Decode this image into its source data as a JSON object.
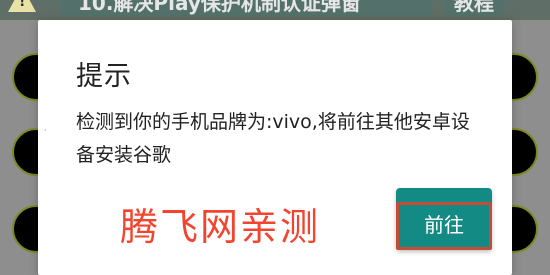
{
  "background": {
    "title_button": "10.解决Play保护机制认证弹窗",
    "tutorial_button": "教程"
  },
  "dialog": {
    "title": "提示",
    "message": "检测到你的手机品牌为:vivo,将前往其他安卓设备安装谷歌",
    "confirm_label": "前往"
  },
  "watermark": "腾飞网亲测",
  "colors": {
    "accent": "#138a84",
    "watermark": "#f2442f",
    "highlight_border": "#c24e38"
  },
  "icons": {
    "warning": "warning-icon"
  }
}
